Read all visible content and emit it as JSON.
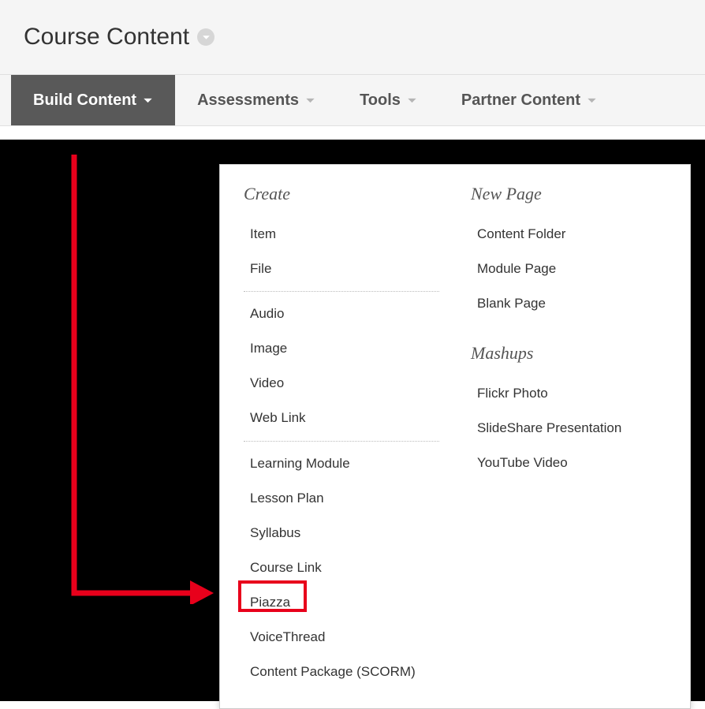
{
  "header": {
    "title": "Course Content"
  },
  "toolbar": {
    "build_content": "Build Content",
    "assessments": "Assessments",
    "tools": "Tools",
    "partner_content": "Partner Content"
  },
  "dropdown": {
    "create": {
      "heading": "Create",
      "group1": [
        "Item",
        "File"
      ],
      "group2": [
        "Audio",
        "Image",
        "Video",
        "Web Link"
      ],
      "group3": [
        "Learning Module",
        "Lesson Plan",
        "Syllabus",
        "Course Link",
        "Piazza",
        "VoiceThread",
        "Content Package (SCORM)"
      ]
    },
    "newpage": {
      "heading": "New Page",
      "items": [
        "Content Folder",
        "Module Page",
        "Blank Page"
      ]
    },
    "mashups": {
      "heading": "Mashups",
      "items": [
        "Flickr Photo",
        "SlideShare Presentation",
        "YouTube Video"
      ]
    }
  }
}
